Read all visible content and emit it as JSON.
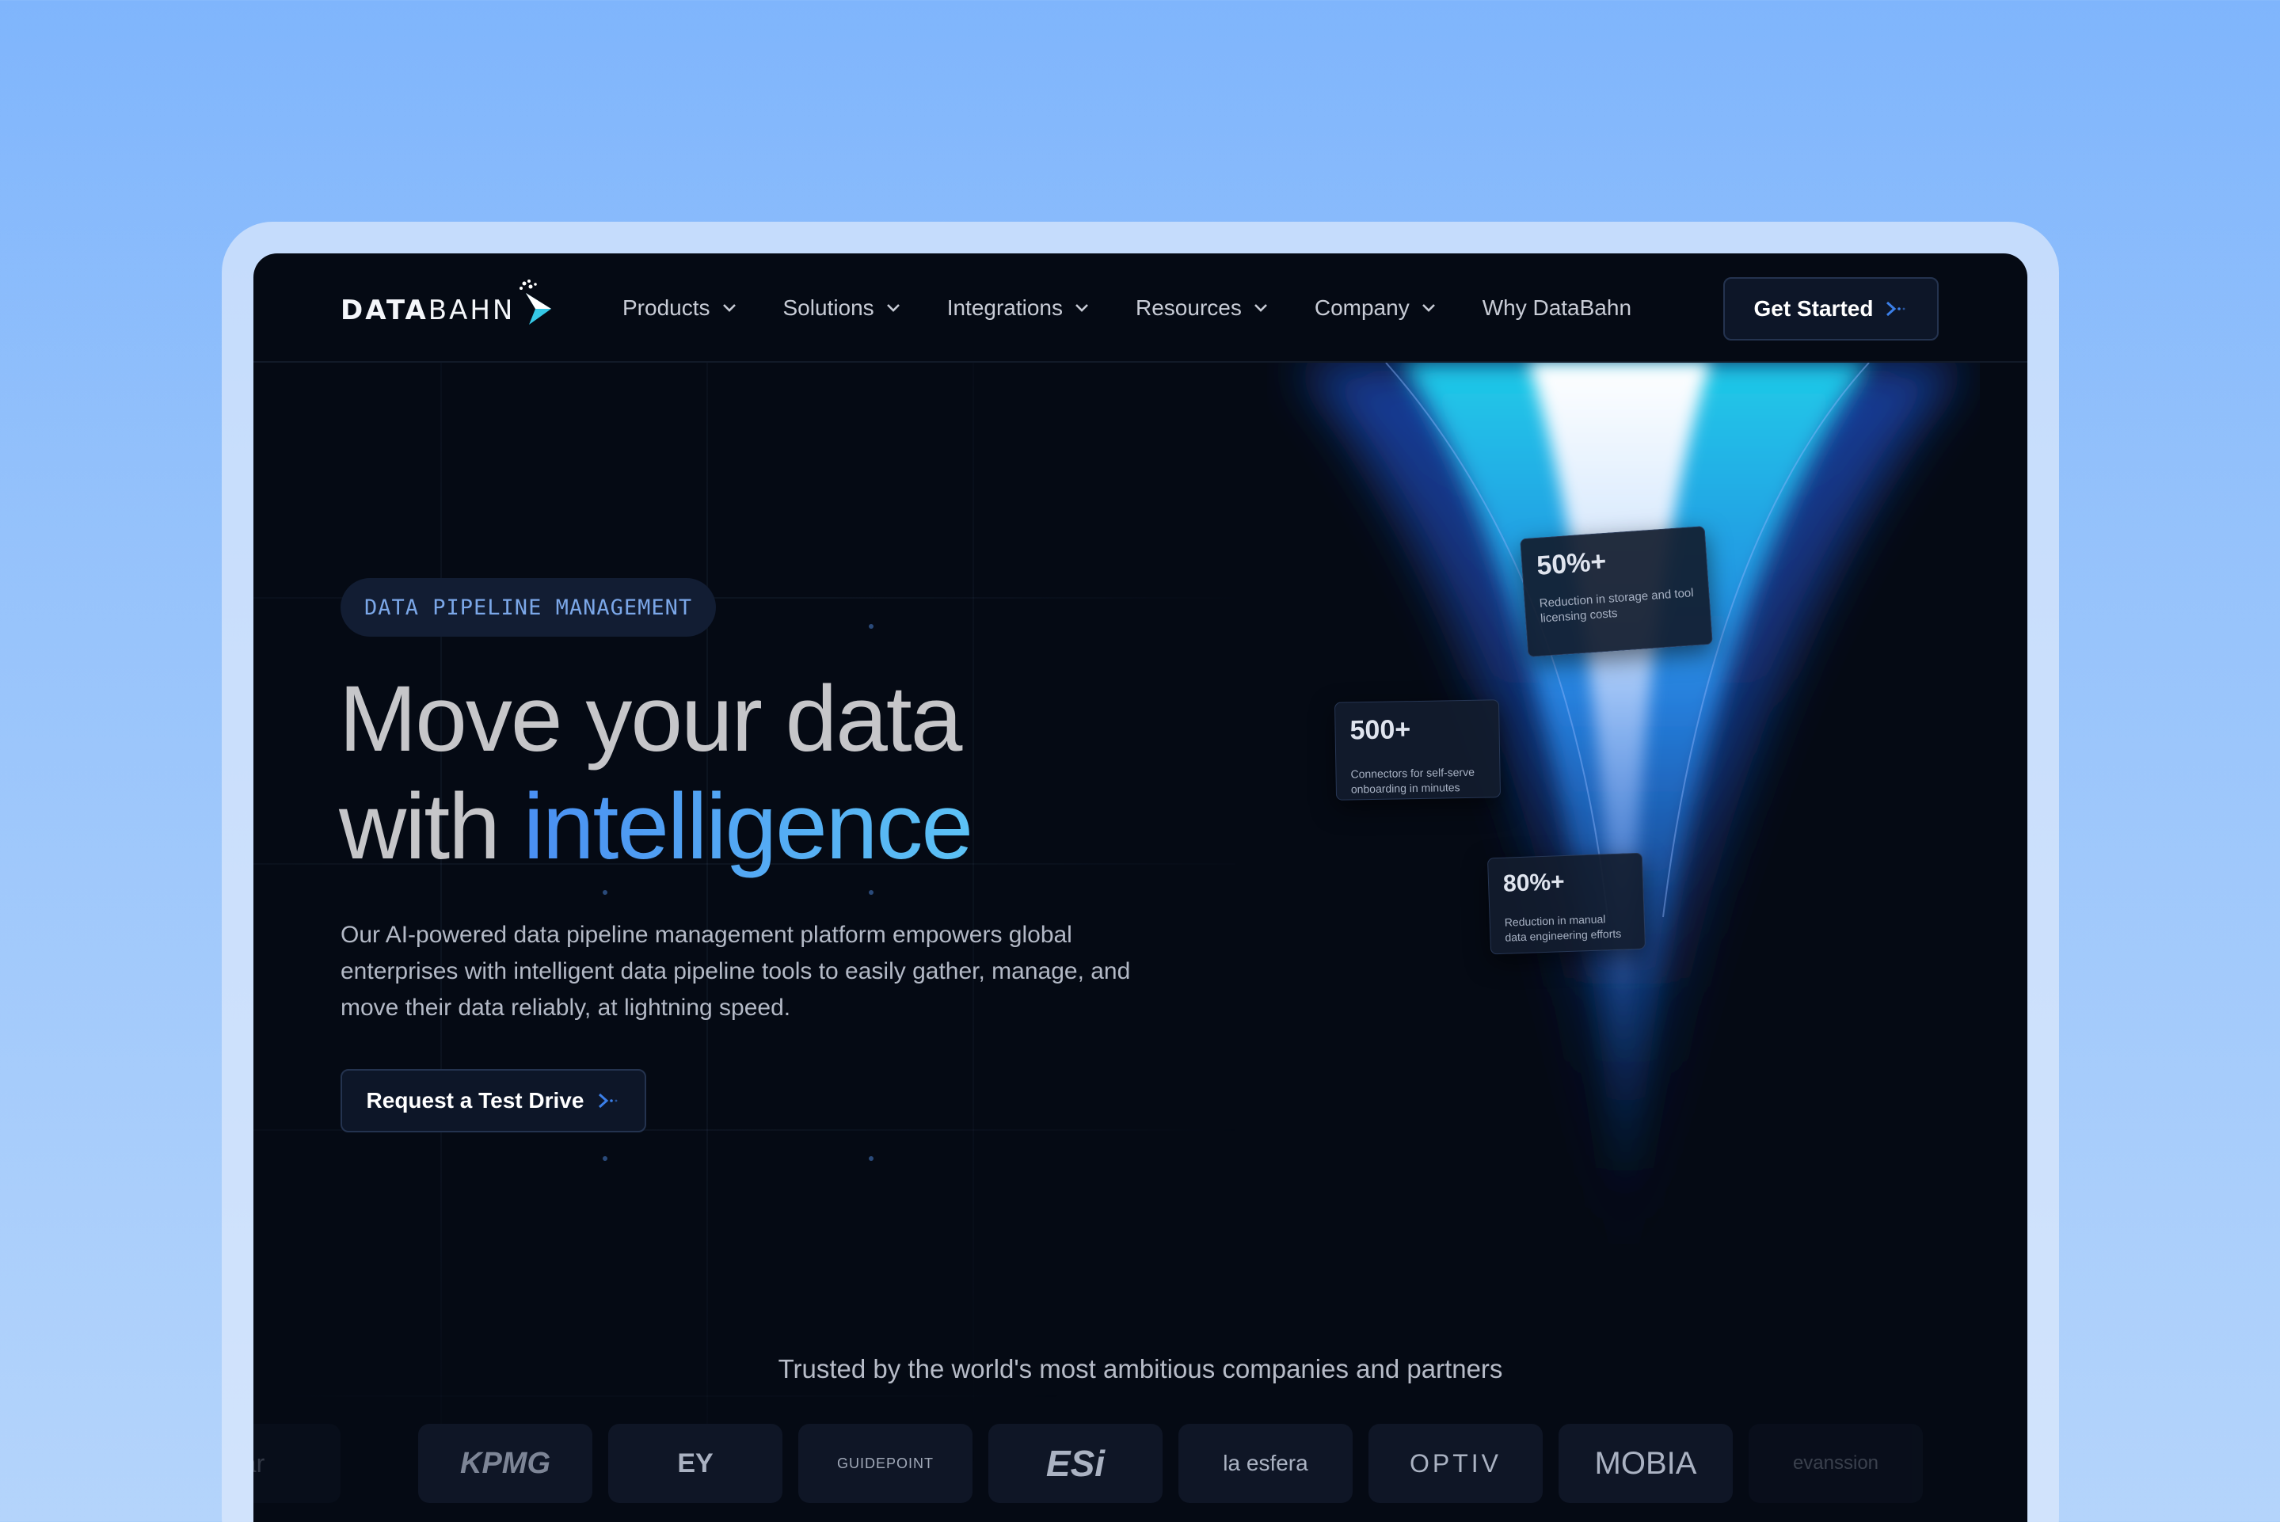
{
  "nav": {
    "brand": {
      "bold": "DATA",
      "light": "BAHN"
    },
    "items": [
      {
        "label": "Products",
        "has_dropdown": true
      },
      {
        "label": "Solutions",
        "has_dropdown": true
      },
      {
        "label": "Integrations",
        "has_dropdown": true
      },
      {
        "label": "Resources",
        "has_dropdown": true
      },
      {
        "label": "Company",
        "has_dropdown": true
      },
      {
        "label": "Why DataBahn",
        "has_dropdown": false
      }
    ],
    "cta": "Get Started"
  },
  "hero": {
    "badge": "DATA PIPELINE MANAGEMENT",
    "headline_line1": "Move your data",
    "headline_line2_prefix": "with ",
    "headline_highlight": "intelligence",
    "subtitle": "Our AI-powered data pipeline management platform empowers global enterprises with intelligent data pipeline tools to easily gather, manage, and move their data reliably, at lightning speed.",
    "cta": "Request a Test Drive"
  },
  "stats": [
    {
      "value": "50%+",
      "description": "Reduction in storage and tool licensing costs"
    },
    {
      "value": "500+",
      "description": "Connectors for self-serve onboarding in minutes"
    },
    {
      "value": "80%+",
      "description": "Reduction in manual data engineering efforts"
    }
  ],
  "trusted": {
    "heading": "Trusted by the world's most ambitious companies and partners",
    "logos": [
      "ar",
      "KPMG",
      "EY",
      "GUIDEPOINT",
      "ESi",
      "la esfera",
      "OPTIV",
      "MOBIA",
      "evanssion"
    ]
  },
  "colors": {
    "background": "#050a14",
    "accent": "#4a8ff2",
    "accent_light": "#5cc2f5",
    "page_bg": "#8ab9fb"
  }
}
